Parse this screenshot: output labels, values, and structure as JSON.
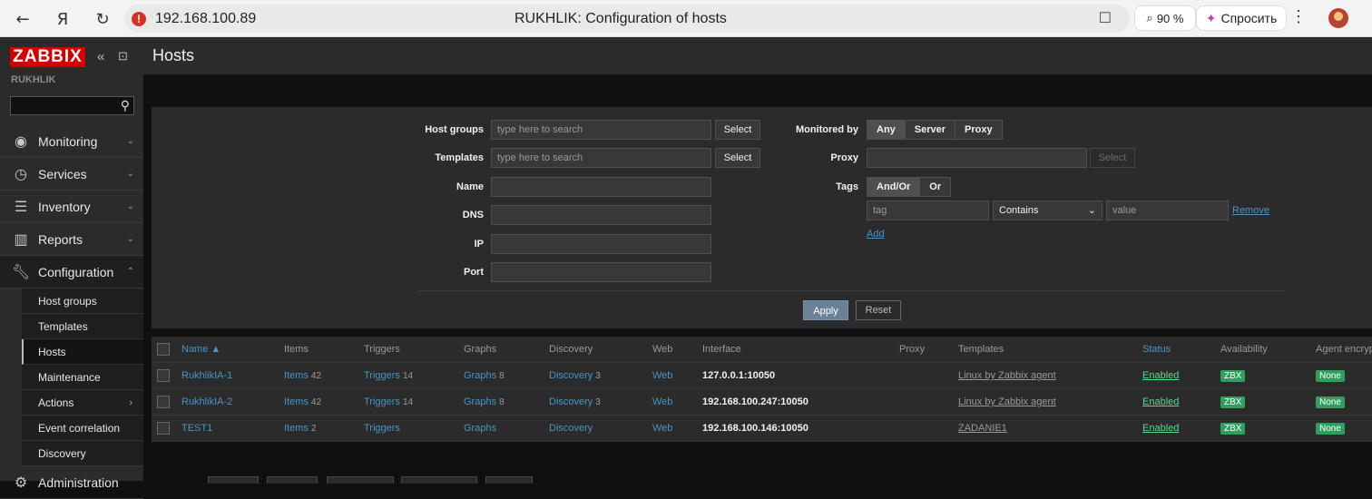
{
  "browser": {
    "url": "192.168.100.89",
    "page_title": "RUKHLIK: Configuration of hosts",
    "zoom": "90 %",
    "ask_label": "Спросить"
  },
  "sidebar": {
    "logo": "ZABBIX",
    "instance": "RUKHLIK",
    "search_value": "",
    "menu": [
      {
        "label": "Monitoring",
        "icon": "eye-icon"
      },
      {
        "label": "Services",
        "icon": "stopwatch-icon"
      },
      {
        "label": "Inventory",
        "icon": "list-icon"
      },
      {
        "label": "Reports",
        "icon": "bar-chart-icon"
      },
      {
        "label": "Configuration",
        "icon": "wrench-icon"
      },
      {
        "label": "Administration",
        "icon": "gear-icon"
      }
    ],
    "submenu": [
      "Host groups",
      "Templates",
      "Hosts",
      "Maintenance",
      "Actions",
      "Event correlation",
      "Discovery"
    ]
  },
  "header": {
    "title": "Hosts"
  },
  "filter": {
    "host_groups_label": "Host groups",
    "templates_label": "Templates",
    "name_label": "Name",
    "dns_label": "DNS",
    "ip_label": "IP",
    "port_label": "Port",
    "search_placeholder": "type here to search",
    "select_label": "Select",
    "monitored_by_label": "Monitored by",
    "monitored_by_options": [
      "Any",
      "Server",
      "Proxy"
    ],
    "proxy_label": "Proxy",
    "tags_label": "Tags",
    "tags_options": [
      "And/Or",
      "Or"
    ],
    "tag_placeholder": "tag",
    "operator_value": "Contains",
    "value_placeholder": "value",
    "remove_label": "Remove",
    "add_label": "Add",
    "apply_label": "Apply",
    "reset_label": "Reset"
  },
  "table": {
    "headers": [
      "Name ▲",
      "Items",
      "Triggers",
      "Graphs",
      "Discovery",
      "Web",
      "Interface",
      "Proxy",
      "Templates",
      "Status",
      "Availability",
      "Agent encryp"
    ],
    "rows": [
      {
        "name": "RukhlikIA-1",
        "items": "Items",
        "items_count": "42",
        "triggers": "Triggers",
        "triggers_count": "14",
        "graphs": "Graphs",
        "graphs_count": "8",
        "discovery": "Discovery",
        "discovery_count": "3",
        "web": "Web",
        "interface": "127.0.0.1:10050",
        "template": "Linux by Zabbix agent",
        "status": "Enabled",
        "availability": "ZBX",
        "encryption": "None"
      },
      {
        "name": "RukhlikIA-2",
        "items": "Items",
        "items_count": "42",
        "triggers": "Triggers",
        "triggers_count": "14",
        "graphs": "Graphs",
        "graphs_count": "8",
        "discovery": "Discovery",
        "discovery_count": "3",
        "web": "Web",
        "interface": "192.168.100.247:10050",
        "template": "Linux by Zabbix agent",
        "status": "Enabled",
        "availability": "ZBX",
        "encryption": "None"
      },
      {
        "name": "TEST1",
        "items": "Items",
        "items_count": "2",
        "triggers": "Triggers",
        "triggers_count": "",
        "graphs": "Graphs",
        "graphs_count": "",
        "discovery": "Discovery",
        "discovery_count": "",
        "web": "Web",
        "interface": "192.168.100.146:10050",
        "template": "ZADANIE1",
        "status": "Enabled",
        "availability": "ZBX",
        "encryption": "None"
      }
    ]
  },
  "colors": {
    "accent_link": "#4796c4",
    "enabled": "#59db8f",
    "badge_green": "#2f9f5e",
    "logo_red": "#d40000"
  }
}
